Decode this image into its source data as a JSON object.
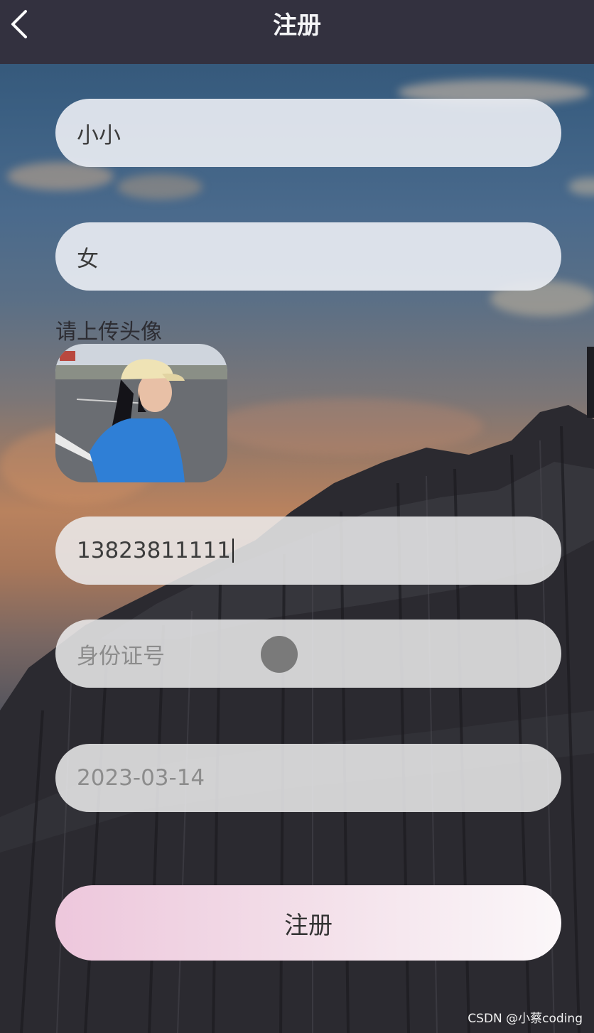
{
  "header": {
    "title": "注册",
    "back_icon": "chevron-left-icon"
  },
  "form": {
    "name_value": "小小",
    "gender_value": "女",
    "avatar_label": "请上传头像",
    "phone_value": "13823811111",
    "id_number_placeholder": "身份证号",
    "birthdate_value": "2023-03-14"
  },
  "submit_label": "注册",
  "watermark": "CSDN @小蔡coding",
  "colors": {
    "header_bg": "#33313f",
    "input_bg": "#e8ecf2",
    "button_gradient_start": "#edc7dc",
    "button_gradient_end": "#fbf7f9"
  }
}
